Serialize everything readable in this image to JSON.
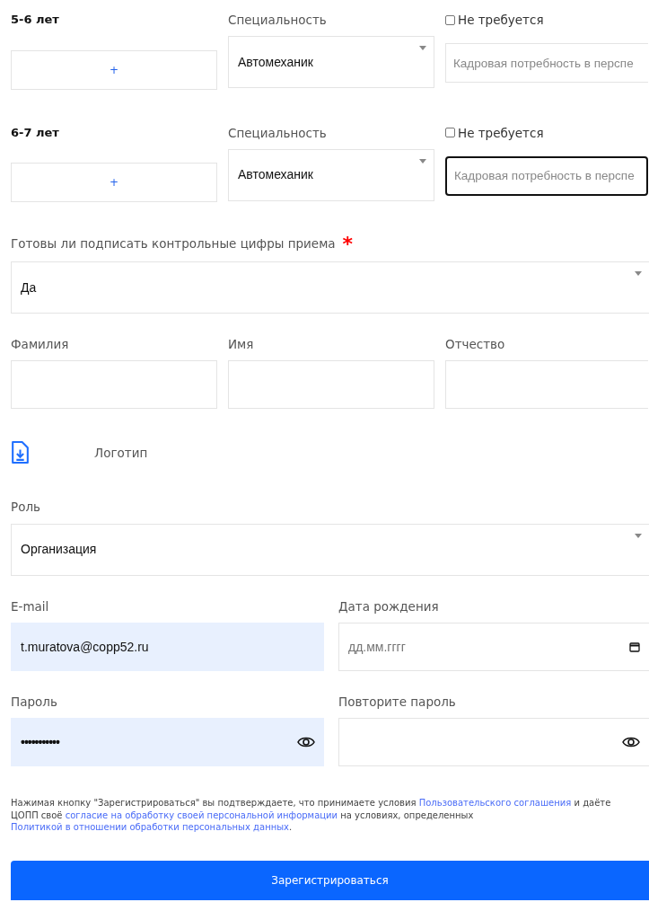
{
  "age_rows": [
    {
      "label": "5-6 лет",
      "add_button": "+",
      "specialty_label": "Специальность",
      "specialty_value": "Автомеханик",
      "not_required_label": "Не требуется",
      "not_required_checked": false,
      "need_placeholder": "Кадровая потребность в перспе",
      "need_focused": false
    },
    {
      "label": "6-7 лет",
      "add_button": "+",
      "specialty_label": "Специальность",
      "specialty_value": "Автомеханик",
      "not_required_label": "Не требуется",
      "not_required_checked": false,
      "need_placeholder": "Кадровая потребность в перспе",
      "need_focused": true
    }
  ],
  "ready_question": {
    "label": "Готовы ли подписать контрольные цифры приема",
    "required_mark": "*",
    "value": "Да"
  },
  "name_fields": [
    {
      "label": "Фамилия"
    },
    {
      "label": "Имя"
    },
    {
      "label": "Отчество"
    }
  ],
  "logo": {
    "label": "Логотип"
  },
  "role": {
    "label": "Роль",
    "value": "Организация"
  },
  "account_fields": [
    {
      "kind": "email",
      "label": "E-mail",
      "value": "t.muratova@copp52.ru",
      "autofilled": true
    },
    {
      "kind": "date",
      "label": "Дата рождения",
      "placeholder": "дд.мм.гггг",
      "autofilled": false
    },
    {
      "kind": "password",
      "label": "Пароль",
      "value": "•••••••••••",
      "autofilled": true
    },
    {
      "kind": "password",
      "label": "Повторите пароль",
      "autofilled": false
    }
  ],
  "consent": [
    {
      "kind": "text",
      "text": "Нажимая кнопку \"Зарегистрироваться\" вы подтверждаете, что принимаете условия "
    },
    {
      "kind": "link",
      "text": "Пользовательского соглашения"
    },
    {
      "kind": "text",
      "text": " и даёте ЦОПП своё "
    },
    {
      "kind": "link",
      "text": "согласие на обработку своей персональной информации"
    },
    {
      "kind": "text",
      "text": " на условиях, определенных "
    },
    {
      "kind": "link",
      "text": "Политикой в отношении обработки персональных данных"
    },
    {
      "kind": "text",
      "text": "."
    }
  ],
  "submit_button": "Зарегистрироваться"
}
